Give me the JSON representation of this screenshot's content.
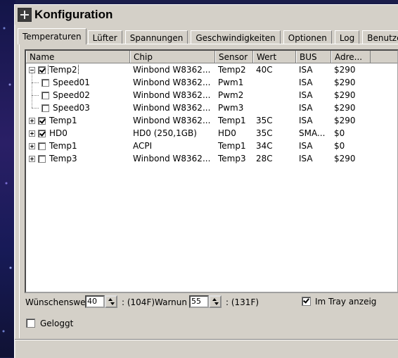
{
  "window": {
    "title": "Konfiguration"
  },
  "tabs": [
    "Temperaturen",
    "Lüfter",
    "Spannungen",
    "Geschwindigkeiten",
    "Optionen",
    "Log",
    "Benutzer"
  ],
  "list": {
    "columns": [
      "Name",
      "Chip",
      "Sensor",
      "Wert",
      "BUS",
      "Adre..."
    ],
    "rows": [
      {
        "name": "Temp2",
        "chip": "Winbond W8362...",
        "sensor": "Temp2",
        "wert": "40C",
        "bus": "ISA",
        "adr": "$290"
      },
      {
        "name": "Speed01",
        "chip": "Winbond W8362...",
        "sensor": "Pwm1",
        "wert": "",
        "bus": "ISA",
        "adr": "$290"
      },
      {
        "name": "Speed02",
        "chip": "Winbond W8362...",
        "sensor": "Pwm2",
        "wert": "",
        "bus": "ISA",
        "adr": "$290"
      },
      {
        "name": "Speed03",
        "chip": "Winbond W8362...",
        "sensor": "Pwm3",
        "wert": "",
        "bus": "ISA",
        "adr": "$290"
      },
      {
        "name": "Temp1",
        "chip": "Winbond W8362...",
        "sensor": "Temp1",
        "wert": "35C",
        "bus": "ISA",
        "adr": "$290"
      },
      {
        "name": "HD0",
        "chip": "HD0 (250,1GB)",
        "sensor": "HD0",
        "wert": "35C",
        "bus": "SMA...",
        "adr": "$0"
      },
      {
        "name": "Temp1",
        "chip": "ACPI",
        "sensor": "Temp1",
        "wert": "34C",
        "bus": "ISA",
        "adr": "$0"
      },
      {
        "name": "Temp3",
        "chip": "Winbond W8362...",
        "sensor": "Temp3",
        "wert": "28C",
        "bus": "ISA",
        "adr": "$290"
      }
    ]
  },
  "bottom": {
    "desired_label": "Wünschenswe",
    "desired_value": "40",
    "desired_f": ": (104F)",
    "warning_label": "Warnun",
    "warning_value": "55",
    "warning_f": ": (131F)",
    "tray_label": "Im Tray anzeig",
    "logged_label": "Geloggt"
  }
}
